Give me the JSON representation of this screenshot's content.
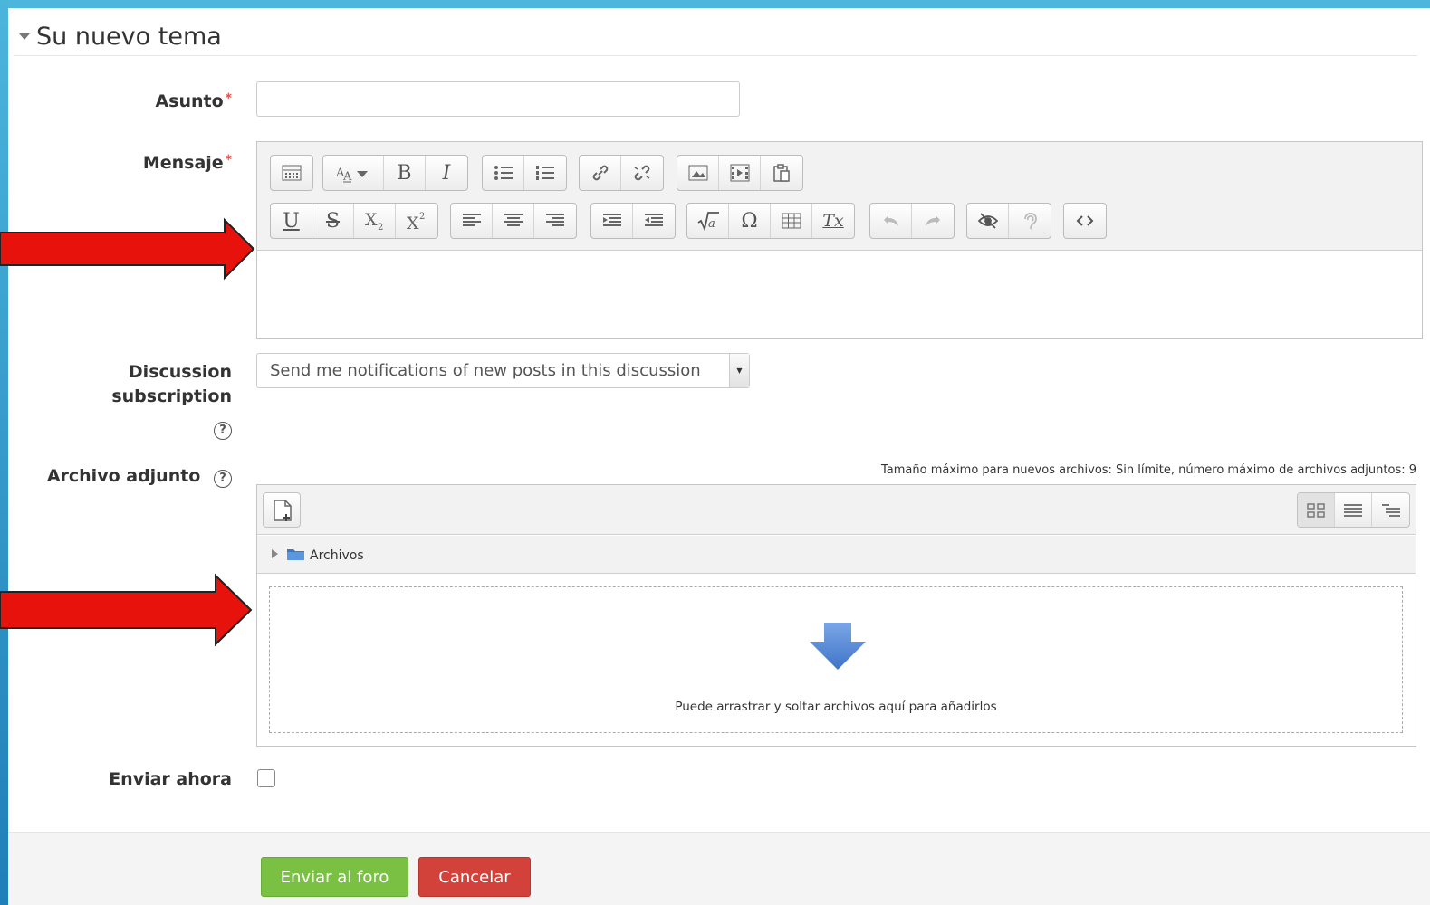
{
  "form": {
    "section_title": "Su nuevo tema",
    "required_marker": "*",
    "subject": {
      "label": "Asunto",
      "value": ""
    },
    "message": {
      "label": "Mensaje",
      "value": "",
      "toolbar_row1": [
        "toggle-toolbar",
        "font-size",
        "bold",
        "italic",
        "unordered-list",
        "ordered-list",
        "link",
        "unlink",
        "image",
        "media",
        "paste"
      ],
      "toolbar_row2": [
        "underline",
        "strikethrough",
        "subscript",
        "superscript",
        "align-left",
        "align-center",
        "align-right",
        "indent",
        "outdent",
        "equation",
        "special-character",
        "table",
        "clear-formatting",
        "undo",
        "redo",
        "accessibility-checker",
        "screen-reader-helper",
        "html-source"
      ],
      "glyphs": {
        "bold": "B",
        "italic": "I",
        "underline": "U",
        "strike": "S",
        "omega": "Ω",
        "tx": "Tx"
      }
    },
    "subscription": {
      "label_line1": "Discussion",
      "label_line2": "subscription",
      "selected": "Send me notifications of new posts in this discussion"
    },
    "attachment": {
      "label": "Archivo adjunto",
      "max_size_text": "Tamaño máximo para nuevos archivos: Sin límite, número máximo de archivos adjuntos: 9",
      "folder_label": "Archivos",
      "drop_text": "Puede arrastrar y soltar archivos aquí para añadirlos"
    },
    "send_now": {
      "label": "Enviar ahora",
      "checked": false
    },
    "buttons": {
      "submit": "Enviar al foro",
      "cancel": "Cancelar"
    },
    "colors": {
      "submit": "#7ac143",
      "cancel": "#d2413a",
      "required": "#d9534f",
      "arrow": "#e8120c"
    }
  }
}
